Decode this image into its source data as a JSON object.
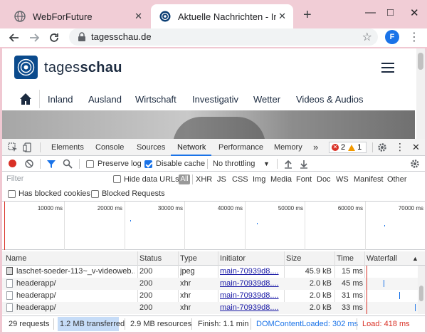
{
  "browser": {
    "tabs": [
      {
        "title": "WebForFuture",
        "active": false
      },
      {
        "title": "Aktuelle Nachrichten - Inl",
        "active": true
      }
    ],
    "close_glyph": "✕",
    "new_tab_glyph": "+",
    "window_controls": {
      "minimize": "—",
      "maximize": "□",
      "close": "✕"
    },
    "url": "tagesschau.de",
    "profile_initial": "F",
    "icons": [
      "back-arrow-icon",
      "forward-arrow-icon",
      "reload-icon",
      "lock-icon",
      "star-icon",
      "menu-dots-icon"
    ]
  },
  "page": {
    "logo_prefix": "tages",
    "logo_suffix": "schau",
    "nav_items": [
      "Inland",
      "Ausland",
      "Wirtschaft",
      "Investigativ",
      "Wetter",
      "Videos & Audios"
    ],
    "colors": {
      "brand": "#0a4a8c",
      "text": "#1c2b40"
    }
  },
  "devtools": {
    "tabs": [
      "Elements",
      "Console",
      "Sources",
      "Network",
      "Performance",
      "Memory"
    ],
    "more_tabs": "»",
    "active_tab": "Network",
    "errors": "2",
    "warnings": "1",
    "toolbar": {
      "preserve_log": "Preserve log",
      "preserve_log_checked": false,
      "disable_cache": "Disable cache",
      "disable_cache_checked": true,
      "throttling": "No throttling"
    },
    "filter": {
      "placeholder": "Filter",
      "hide_data_urls": "Hide data URLs",
      "all": "All",
      "types": [
        "XHR",
        "JS",
        "CSS",
        "Img",
        "Media",
        "Font",
        "Doc",
        "WS",
        "Manifest",
        "Other"
      ],
      "has_blocked_cookies": "Has blocked cookies",
      "blocked_requests": "Blocked Requests"
    },
    "overview_ticks": [
      "10000 ms",
      "20000 ms",
      "30000 ms",
      "40000 ms",
      "50000 ms",
      "60000 ms",
      "70000 ms"
    ],
    "columns": [
      "Name",
      "Status",
      "Type",
      "Initiator",
      "Size",
      "Time",
      "Waterfall"
    ],
    "sort_indicator": "▲",
    "rows": [
      {
        "name": "laschet-soeder-113~_v-videoweb...",
        "status": "200",
        "type": "jpeg",
        "initiator": "main-70939d8....",
        "size": "45.9 kB",
        "time": "15 ms",
        "icon": "image-icon"
      },
      {
        "name": "headerapp/",
        "status": "200",
        "type": "xhr",
        "initiator": "main-70939d8....",
        "size": "2.0 kB",
        "time": "45 ms",
        "icon": "document-icon"
      },
      {
        "name": "headerapp/",
        "status": "200",
        "type": "xhr",
        "initiator": "main-70939d8....",
        "size": "2.0 kB",
        "time": "31 ms",
        "icon": "document-icon"
      },
      {
        "name": "headerapp/",
        "status": "200",
        "type": "xhr",
        "initiator": "main-70939d8....",
        "size": "2.0 kB",
        "time": "33 ms",
        "icon": "document-icon"
      }
    ],
    "status_bar": {
      "requests": "29 requests",
      "transferred": "1.2 MB transferred",
      "resources": "2.9 MB resources",
      "finish": "Finish: 1.1 min",
      "dom_content_loaded": "DOMContentLoaded: 302 ms",
      "load": "Load: 418 ms"
    },
    "colors": {
      "accent": "#1a73e8",
      "error": "#d93025",
      "dcl": "#1a73e8",
      "load": "#d93025"
    }
  }
}
